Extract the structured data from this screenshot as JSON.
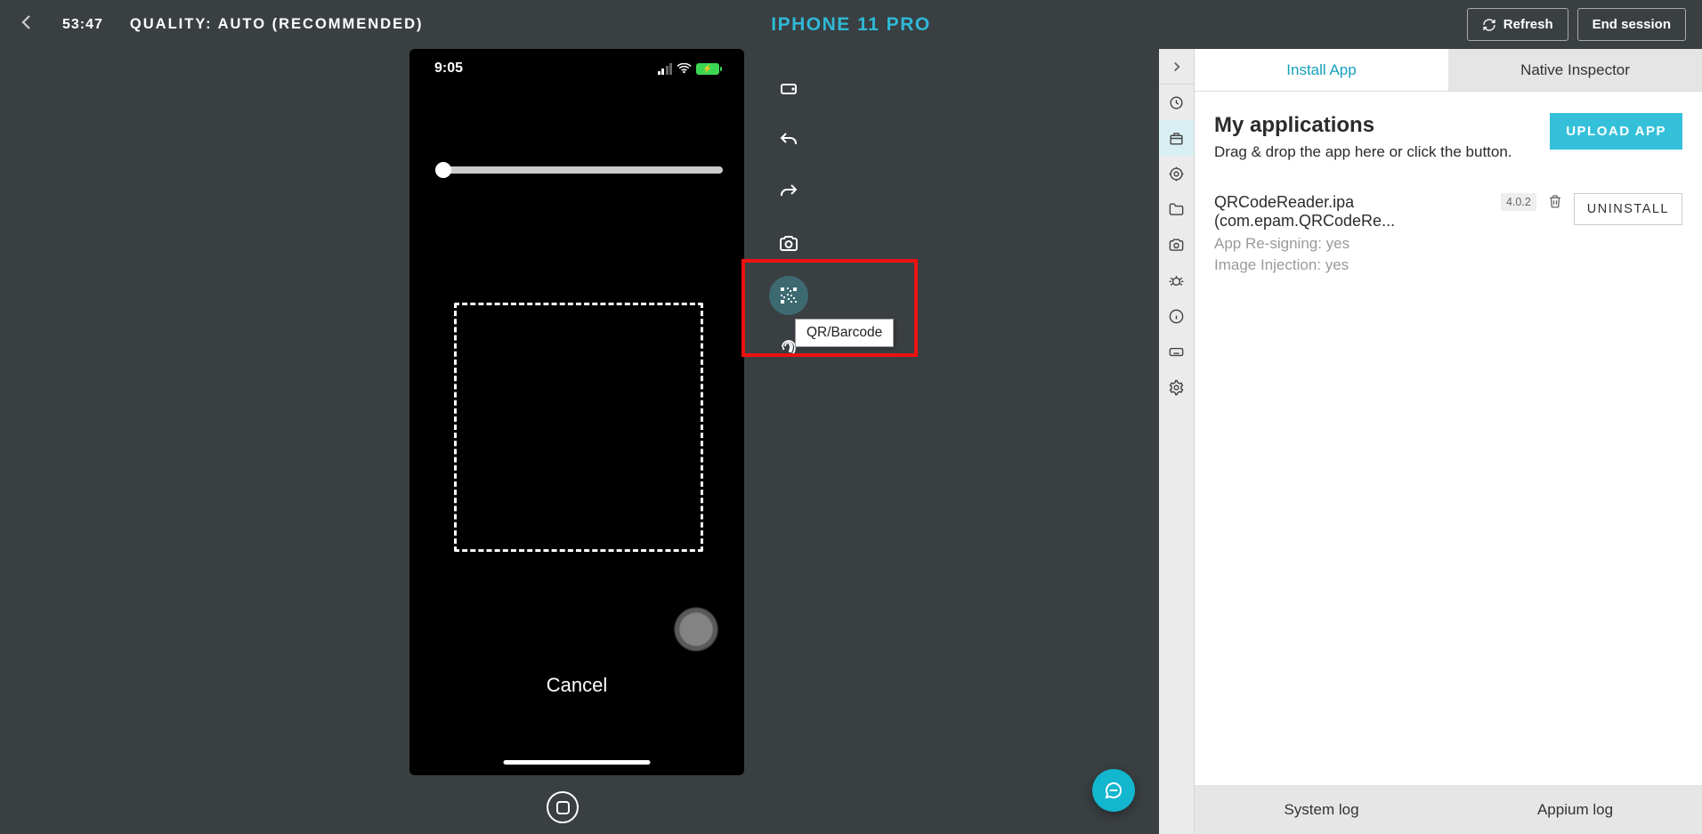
{
  "header": {
    "timer": "53:47",
    "quality": "QUALITY: AUTO (RECOMMENDED)",
    "device": "IPHONE 11 PRO",
    "refresh": "Refresh",
    "end": "End session"
  },
  "phone": {
    "time": "9:05",
    "cancel": "Cancel"
  },
  "tool_tooltip": "QR/Barcode",
  "side_tabs": {
    "install": "Install App",
    "inspector": "Native Inspector"
  },
  "apps": {
    "title": "My applications",
    "subtitle": "Drag & drop the app here or click the button.",
    "upload": "UPLOAD APP",
    "app_name": "QRCodeReader.ipa (com.epam.QRCodeRe...",
    "resign": "App Re-signing: yes",
    "imageinj": "Image Injection: yes",
    "version": "4.0.2",
    "uninstall": "UNINSTALL"
  },
  "footer": {
    "syslog": "System log",
    "appium": "Appium log"
  }
}
